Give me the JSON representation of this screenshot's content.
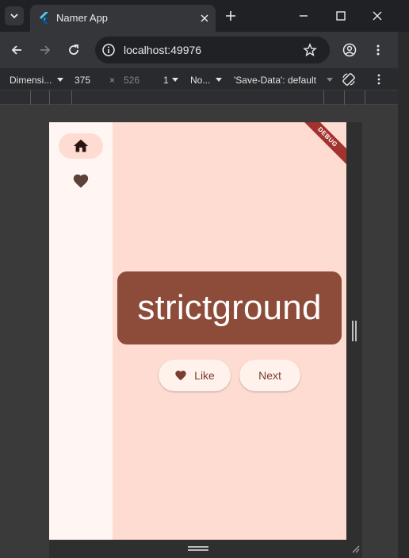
{
  "browser": {
    "tab_title": "Namer App",
    "url": "localhost:49976"
  },
  "devtools": {
    "device_label": "Dimensi...",
    "width": "375",
    "times": "×",
    "height": "526",
    "dpr": "1",
    "throttle": "No...",
    "save_data": "'Save-Data': default"
  },
  "app": {
    "debug_banner": "DEBUG",
    "word": "strictground",
    "like_label": "Like",
    "next_label": "Next",
    "colors": {
      "primary": "#8d4b3a",
      "background": "#fedcd2",
      "rail": "#fff5f2",
      "rail_selected": "#fedcd2",
      "button": "#fff1ec"
    },
    "rail_items": [
      {
        "icon": "home-icon",
        "selected": true
      },
      {
        "icon": "favorite-icon",
        "selected": false
      }
    ]
  }
}
